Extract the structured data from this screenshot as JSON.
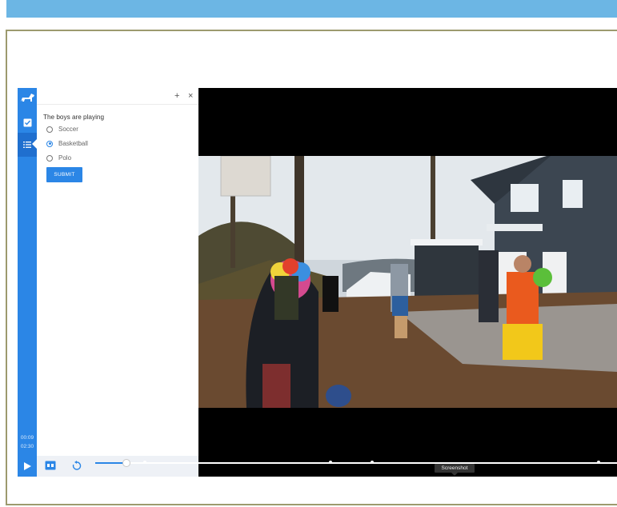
{
  "quiz": {
    "question": "The boys are playing",
    "options": [
      "Soccer",
      "Basketball",
      "Polo"
    ],
    "selected_option": "Basketball",
    "submit_label": "SUBMIT"
  },
  "panel": {
    "add_icon": "+",
    "close_icon": "×"
  },
  "player": {
    "elapsed": "00:09",
    "duration": "02:30",
    "progress_fraction": 0.06,
    "tooltip": "Screenshot"
  },
  "colors": {
    "accent": "#2b86e6",
    "top_bar": "#6cb6e4",
    "frame_border": "#9c9a6e"
  },
  "icons": [
    "dog-logo-icon",
    "checkbox-icon",
    "list-icon",
    "play-icon",
    "caption-icon",
    "replay-icon"
  ]
}
